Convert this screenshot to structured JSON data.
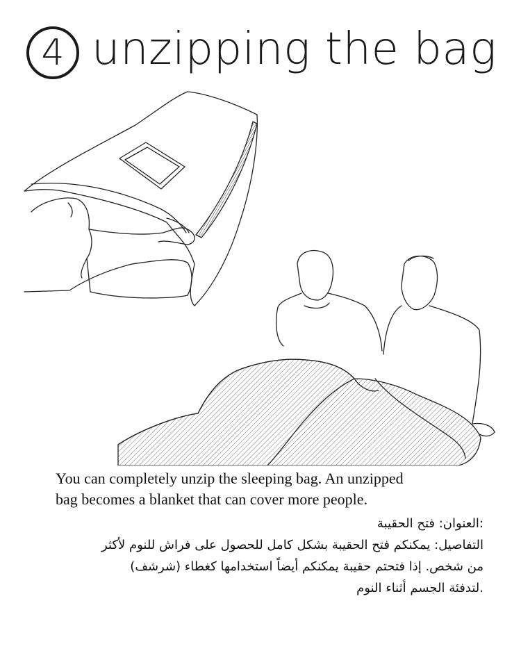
{
  "step": {
    "number": "4",
    "title": "unzipping the bag"
  },
  "illustration": {
    "top_scene": "person-unzipping-sleeping-bag-icon",
    "bottom_scene": "two-men-under-unzipped-bag-icon"
  },
  "caption": {
    "english_line1": "You can completely unzip the sleeping bag. An unzipped",
    "english_line2": "bag becomes a blanket that can cover more people.",
    "arabic_line1": ":العنوان: فتح الحقيبة",
    "arabic_line2": "التفاصيل: يمكنكم فتح الحقيبة بشكل كامل للحصول على فراش للنوم لأكثر",
    "arabic_line3": "من شخص. إذا فتحتم حقيبة يمكنكم أيضاً استخدامها كغطاء (شرشف)",
    "arabic_line4": ".لتدفئة الجسم أثناء النوم"
  }
}
